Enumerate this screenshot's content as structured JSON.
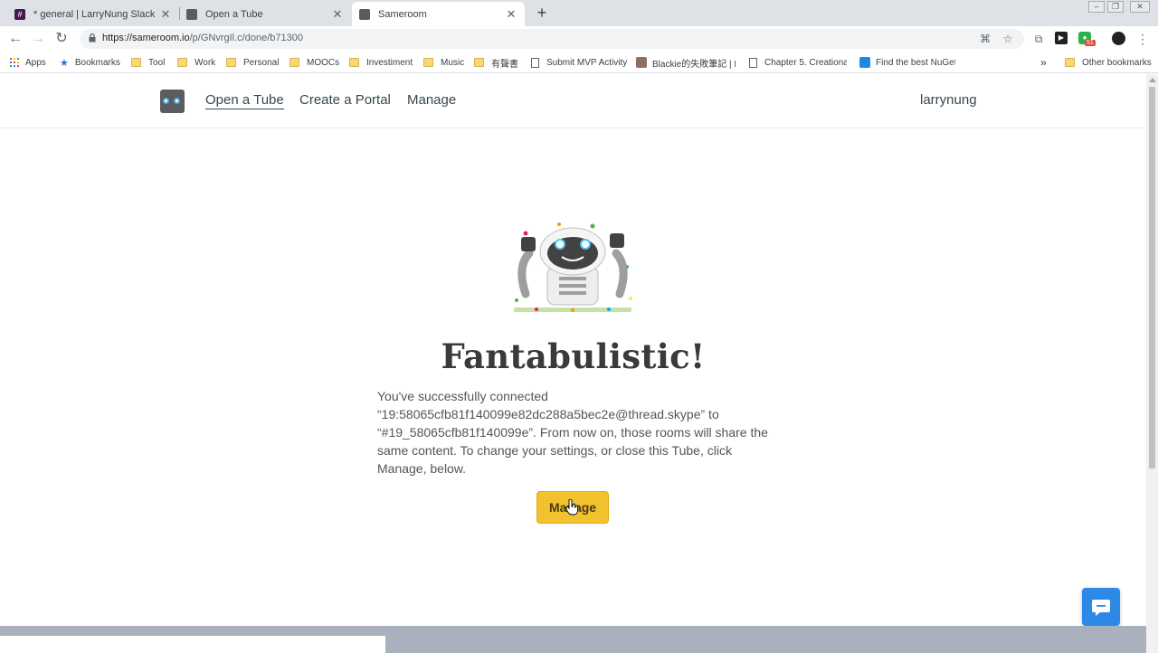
{
  "browser": {
    "tabs": [
      {
        "title": "* general | LarryNung Slack",
        "favicon_color": "#4a154b",
        "active": false
      },
      {
        "title": "Open a Tube",
        "favicon_color": "#5a5c60",
        "active": false
      },
      {
        "title": "Sameroom",
        "favicon_color": "#5a5c60",
        "active": true
      }
    ],
    "url_host": "https://sameroom.io",
    "url_path": "/p/GNvrgIl.c/done/b71300",
    "bookmarks": [
      {
        "label": "Apps",
        "kind": "apps"
      },
      {
        "label": "Bookmarks",
        "kind": "star"
      },
      {
        "label": "Tool",
        "kind": "folder"
      },
      {
        "label": "Work",
        "kind": "folder"
      },
      {
        "label": "Personal",
        "kind": "folder"
      },
      {
        "label": "MOOCs",
        "kind": "folder"
      },
      {
        "label": "Investiment",
        "kind": "folder"
      },
      {
        "label": "Music",
        "kind": "folder"
      },
      {
        "label": "有聲書",
        "kind": "folder"
      },
      {
        "label": "Submit MVP Activity",
        "kind": "page"
      },
      {
        "label": "Blackie的失敗筆記 | E",
        "kind": "pic"
      },
      {
        "label": "Chapter 5. Creational",
        "kind": "page"
      },
      {
        "label": "Find the best NuGet",
        "kind": "nuget"
      }
    ],
    "other_bookmarks": "Other bookmarks",
    "extension_badge": "51"
  },
  "site": {
    "nav": {
      "open_tube": "Open a Tube",
      "create_portal": "Create a Portal",
      "manage": "Manage"
    },
    "username": "larrynung",
    "headline": "Fantabulistic!",
    "message": "You've successfully connected “19:58065cfb81f140099e82dc288a5bec2e@thread.skype” to “#19_58065cfb81f140099e”. From now on, those rooms will share the same content. To change your settings, or close this Tube, click Manage, below.",
    "manage_button": "Manage"
  },
  "colors": {
    "accent_button": "#f2c12e",
    "chat_button": "#2e89e6",
    "footer_band": "#a8b1bd"
  }
}
